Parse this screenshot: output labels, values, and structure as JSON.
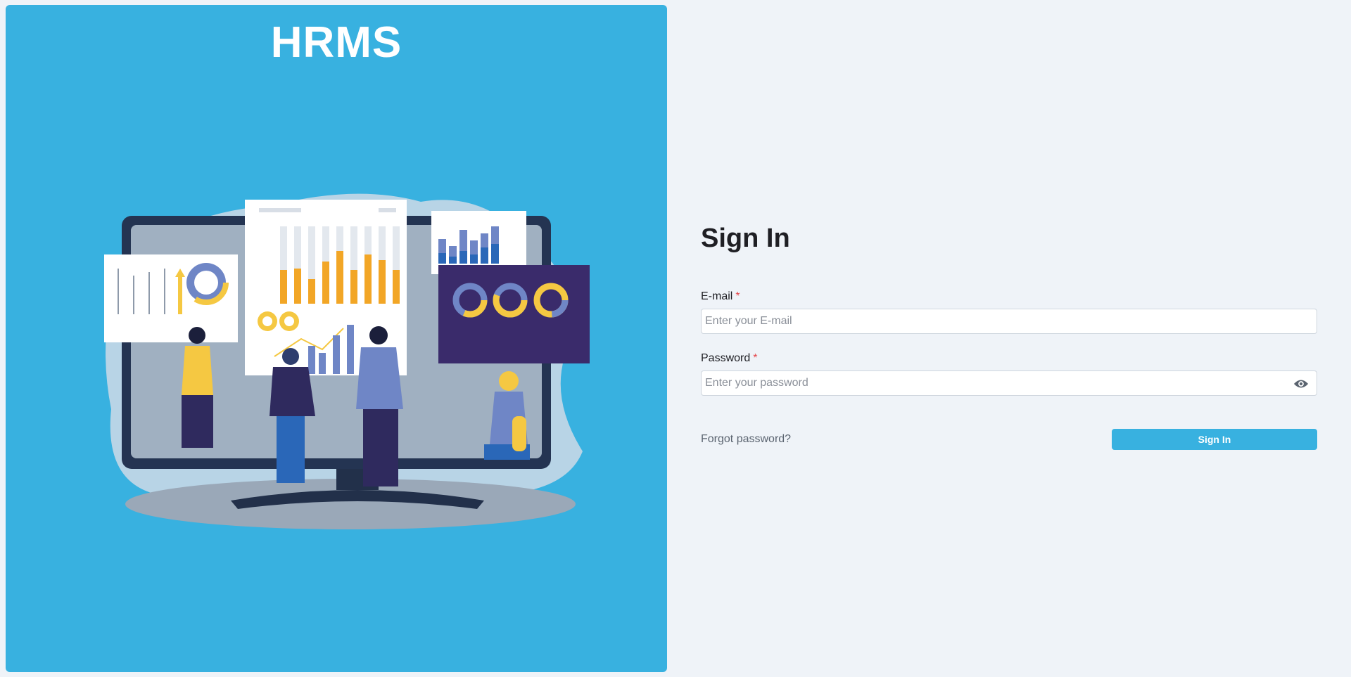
{
  "brand": {
    "title": "HRMS"
  },
  "form": {
    "heading": "Sign In",
    "email": {
      "label": "E-mail",
      "required_mark": "*",
      "value": "",
      "placeholder": "Enter your E-mail"
    },
    "password": {
      "label": "Password",
      "required_mark": "*",
      "value": "",
      "placeholder": "Enter your password",
      "toggle_icon": "eye-icon"
    },
    "forgot_link": "Forgot password?",
    "submit_label": "Sign In"
  },
  "colors": {
    "brand_panel": "#38b1e0",
    "page_background": "#eff3f8",
    "button": "#38b1e0",
    "required": "#e5484d"
  }
}
